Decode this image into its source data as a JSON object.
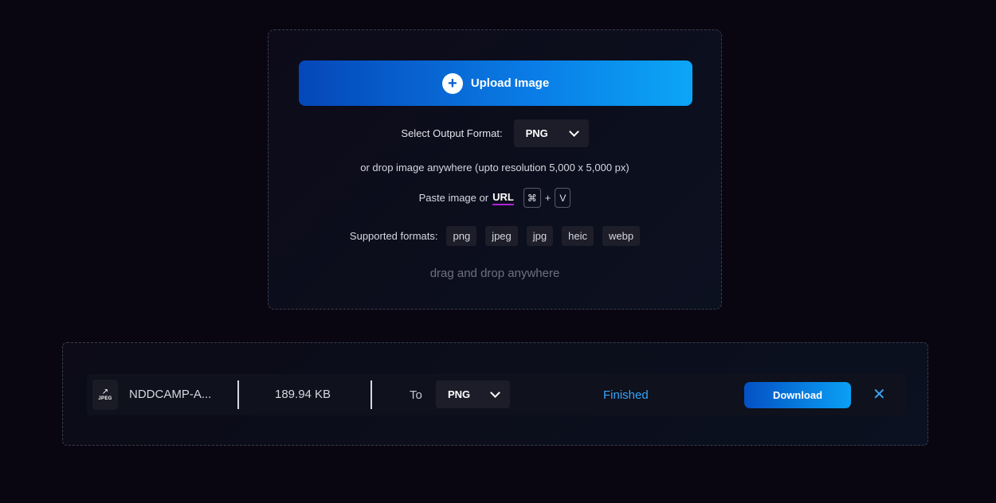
{
  "upload": {
    "button_label": "Upload Image",
    "format_label": "Select Output Format:",
    "format_value": "PNG",
    "drop_note": "or drop image anywhere (upto resolution 5,000 x 5,000 px)",
    "paste_text": "Paste image or",
    "url_label": "URL",
    "key_cmd": "⌘",
    "key_plus": "+",
    "key_v": "V",
    "supported_label": "Supported formats:",
    "formats": [
      "png",
      "jpeg",
      "jpg",
      "heic",
      "webp"
    ],
    "drag_hint": "drag and drop anywhere"
  },
  "file": {
    "icon_ext": "JPEG",
    "name": "NDDCAMP-A...",
    "size": "189.94 KB",
    "to_label": "To",
    "format_value": "PNG",
    "status": "Finished",
    "download_label": "Download",
    "close_glyph": "✕"
  },
  "colors": {
    "background": "#0a0611",
    "accent_blue": "#0a7de6",
    "status_blue": "#37a4f7",
    "url_underline": "#b022d8"
  }
}
